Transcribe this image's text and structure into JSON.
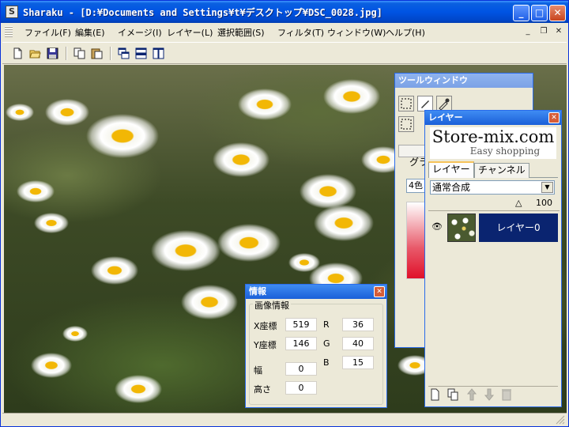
{
  "window": {
    "app_icon_glyph": "S",
    "title": "Sharaku - [D:¥Documents and Settings¥t¥デスクトップ¥DSC_0028.jpg]",
    "controls": {
      "minimize": "_",
      "maximize": "□",
      "close": "✕"
    }
  },
  "menubar": {
    "items": [
      "ファイル(F)",
      "編集(E)",
      "イメージ(I)",
      "レイヤー(L)",
      "選択範囲(S)",
      "フィルタ(T)",
      "ウィンドウ(W)",
      "ヘルプ(H)"
    ],
    "mdi_controls": {
      "minimize": "_",
      "restore": "❐",
      "close": "✕"
    }
  },
  "tool_window": {
    "title": "ツールウィンドウ",
    "gradient_label": "グラ",
    "color_mode_label": "4色"
  },
  "layer_palette": {
    "title": "レイヤー",
    "banner": {
      "brand": "Store-mix.com",
      "tagline": "Easy shopping"
    },
    "tabs": [
      "レイヤー",
      "チャンネル"
    ],
    "blend_mode": "通常合成",
    "opacity": "100",
    "layers": [
      {
        "name": "レイヤー0",
        "visibility_glyph": "👁"
      }
    ]
  },
  "info_palette": {
    "title": "情報",
    "group_label": "画像情報",
    "x_label": "X座標",
    "x_value": "519",
    "y_label": "Y座標",
    "y_value": "146",
    "w_label": "幅",
    "w_value": "0",
    "h_label": "高さ",
    "h_value": "0",
    "r_label": "R",
    "r_value": "36",
    "g_label": "G",
    "g_value": "40",
    "b_label": "B",
    "b_value": "15"
  },
  "colors": {
    "titlebar": "#0054e3",
    "layer_selected": "#0a2470",
    "flower_petal": "#ffffff",
    "flower_center": "#f2b705",
    "foliage": "#3b4a26"
  }
}
